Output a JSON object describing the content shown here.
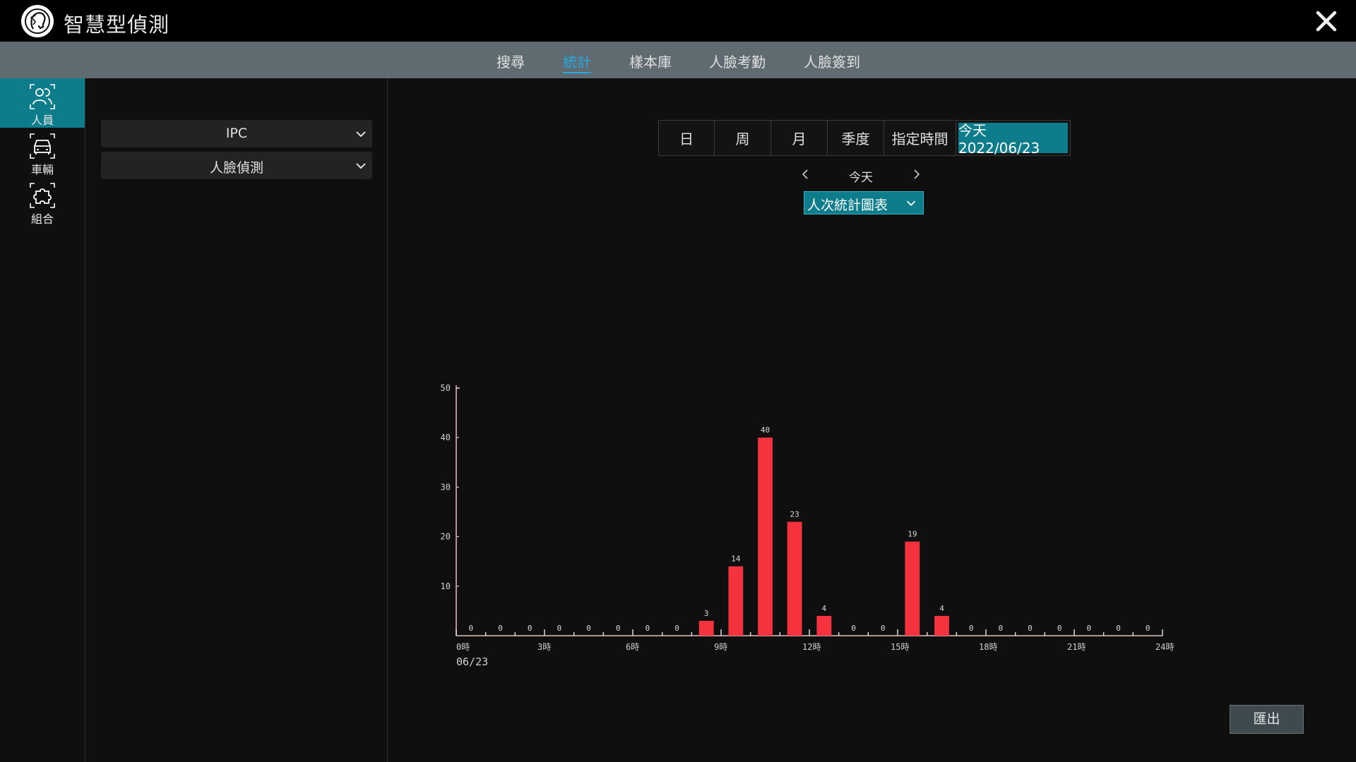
{
  "app": {
    "title": "智慧型偵測"
  },
  "tabs": [
    {
      "label": "搜尋",
      "active": false
    },
    {
      "label": "統計",
      "active": true
    },
    {
      "label": "樣本庫",
      "active": false
    },
    {
      "label": "人臉考勤",
      "active": false
    },
    {
      "label": "人臉簽到",
      "active": false
    }
  ],
  "rail": [
    {
      "label": "人員",
      "icon": "people-icon",
      "active": true
    },
    {
      "label": "車輛",
      "icon": "car-icon",
      "active": false
    },
    {
      "label": "組合",
      "icon": "puzzle-icon",
      "active": false
    }
  ],
  "filters": {
    "source": "IPC",
    "event": "人臉偵測"
  },
  "period": {
    "buttons": [
      "日",
      "周",
      "月",
      "季度",
      "指定時間",
      "今天 2022/06/23"
    ],
    "active_index": 5,
    "nav_label": "今天",
    "chart_type_label": "人次統計圖表"
  },
  "export_label": "匯出",
  "colors": {
    "accent": "#0e7d8b",
    "bar": "#f5333f",
    "active_tab": "#27a9e1"
  },
  "chart_data": {
    "type": "bar",
    "x": [
      0,
      1,
      2,
      3,
      4,
      5,
      6,
      7,
      8,
      9,
      10,
      11,
      12,
      13,
      14,
      15,
      16,
      17,
      18,
      19,
      20,
      21,
      22,
      23
    ],
    "values": [
      0,
      0,
      0,
      0,
      0,
      0,
      0,
      0,
      3,
      14,
      40,
      23,
      4,
      0,
      0,
      19,
      4,
      0,
      0,
      0,
      0,
      0,
      0,
      0
    ],
    "data_labels": [
      "0",
      "0",
      "0",
      "0",
      "0",
      "0",
      "0",
      "0",
      "3",
      "14",
      "40",
      "23",
      "4",
      "0",
      "0",
      "19",
      "4",
      "0",
      "0",
      "0",
      "0",
      "0",
      "0",
      "0"
    ],
    "x_tick_labels": [
      "0時",
      "3時",
      "6時",
      "9時",
      "12時",
      "15時",
      "18時",
      "21時",
      "24時"
    ],
    "x_tick_values": [
      0,
      3,
      6,
      9,
      12,
      15,
      18,
      21,
      24
    ],
    "x_sublabel": "06/23",
    "y_tick_labels": [
      "10",
      "20",
      "30",
      "40",
      "50"
    ],
    "y_tick_values": [
      10,
      20,
      30,
      40,
      50
    ],
    "ylim": [
      0,
      50
    ],
    "xlim": [
      0,
      24
    ],
    "grid": false
  }
}
